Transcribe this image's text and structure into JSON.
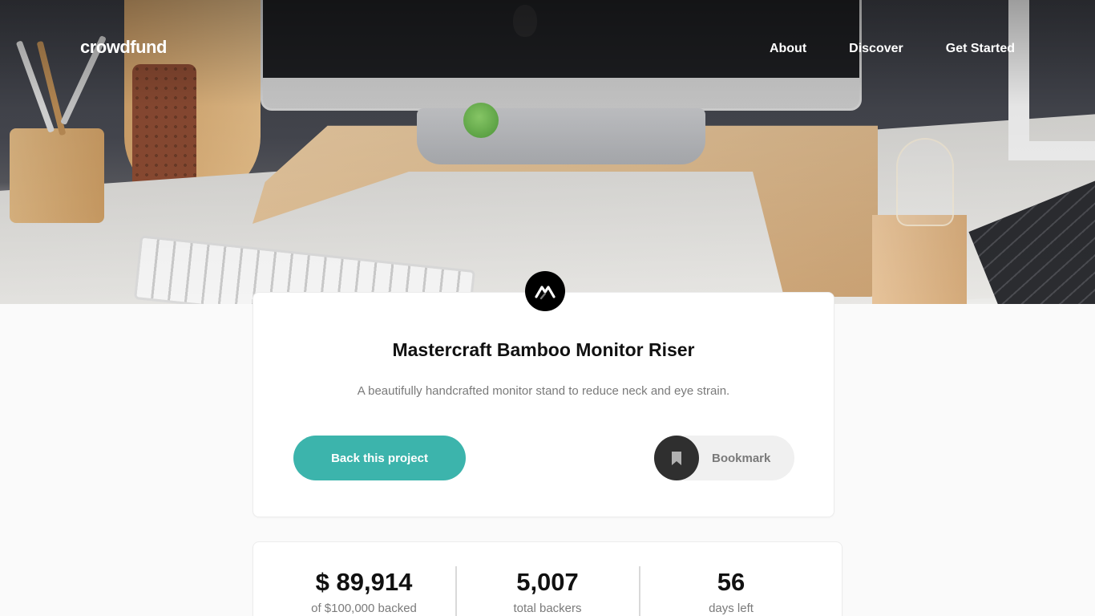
{
  "nav": {
    "logo": "crowdfund",
    "links": [
      "About",
      "Discover",
      "Get Started"
    ]
  },
  "project": {
    "title": "Mastercraft Bamboo Monitor Riser",
    "description": "A beautifully handcrafted monitor stand to reduce neck and eye strain.",
    "back_label": "Back this project",
    "bookmark_label": "Bookmark"
  },
  "stats": [
    {
      "value": "$ 89,914",
      "label": "of $100,000 backed"
    },
    {
      "value": "5,007",
      "label": "total backers"
    },
    {
      "value": "56",
      "label": "days left"
    }
  ],
  "colors": {
    "accent": "#3cb4ac",
    "bookmark_circle": "#2f2f2f",
    "text_muted": "#7a7a7a"
  }
}
